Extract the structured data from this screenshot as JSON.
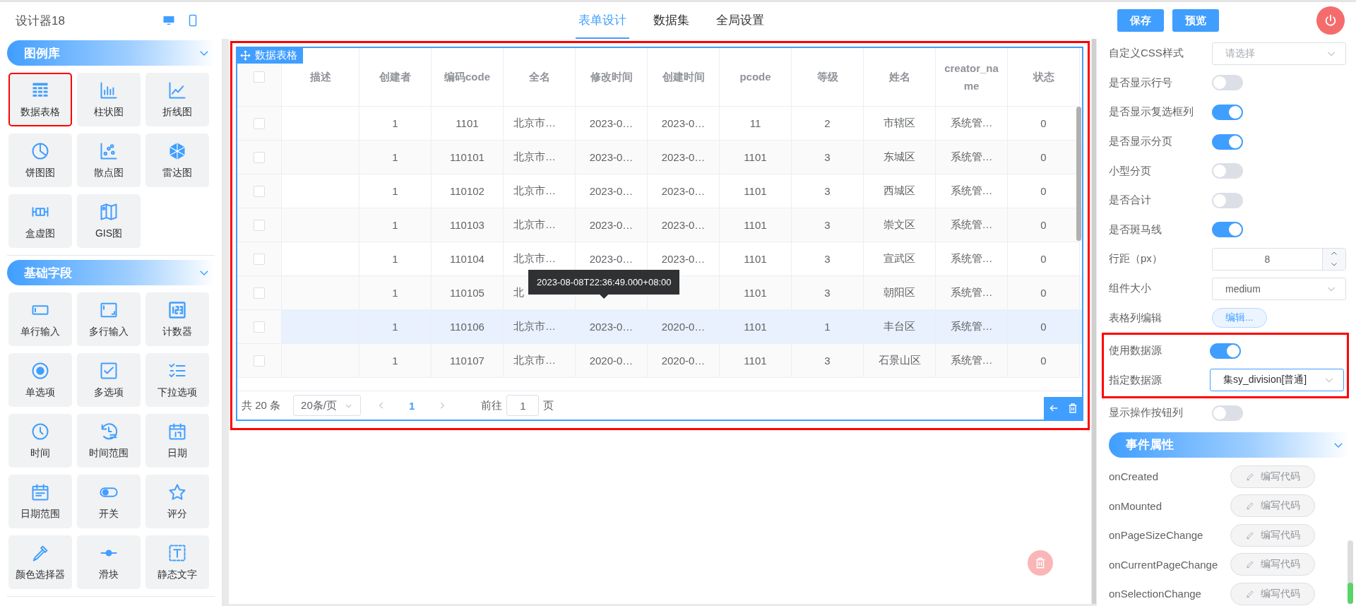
{
  "header": {
    "title": "设计器18",
    "tabs": [
      {
        "label": "表单设计",
        "selected": true
      },
      {
        "label": "数据集",
        "selected": false
      },
      {
        "label": "全局设置",
        "selected": false
      }
    ],
    "buttons": [
      "保存",
      "预览"
    ]
  },
  "palette": [
    {
      "title": "图例库",
      "expanded": true,
      "items": [
        {
          "label": "数据表格",
          "selected": true
        },
        {
          "label": "柱状图",
          "selected": false
        },
        {
          "label": "折线图",
          "selected": false
        },
        {
          "label": "饼图图",
          "selected": false
        },
        {
          "label": "散点图",
          "selected": false
        },
        {
          "label": "雷达图",
          "selected": false
        },
        {
          "label": "盒虚图",
          "selected": false
        },
        {
          "label": "GIS图",
          "selected": false
        }
      ]
    },
    {
      "title": "基础字段",
      "expanded": true,
      "items": [
        {
          "label": "单行输入",
          "selected": false
        },
        {
          "label": "多行输入",
          "selected": false
        },
        {
          "label": "计数器",
          "selected": false
        },
        {
          "label": "单选项",
          "selected": false
        },
        {
          "label": "多选项",
          "selected": false
        },
        {
          "label": "下拉选项",
          "selected": false
        },
        {
          "label": "时间",
          "selected": false
        },
        {
          "label": "时间范围",
          "selected": false
        },
        {
          "label": "日期",
          "selected": false
        },
        {
          "label": "日期范围",
          "selected": false
        },
        {
          "label": "开关",
          "selected": false
        },
        {
          "label": "评分",
          "selected": false
        },
        {
          "label": "颜色选择器",
          "selected": false
        },
        {
          "label": "滑块",
          "selected": false
        },
        {
          "label": "静态文字",
          "selected": false
        }
      ]
    }
  ],
  "table": {
    "tag": "数据表格",
    "columns": [
      "描述",
      "创建者",
      "编码code",
      "全名",
      "修改时间",
      "创建时间",
      "pcode",
      "等级",
      "姓名",
      "creator_name",
      "状态"
    ],
    "rows": [
      {
        "checked": false,
        "highlighted": false,
        "cells": [
          null,
          "1",
          "1101",
          "北京市…",
          "2023-0…",
          "2023-0…",
          "11",
          "2",
          "市辖区",
          "系统管…",
          "0"
        ]
      },
      {
        "checked": false,
        "highlighted": false,
        "cells": [
          null,
          "1",
          "110101",
          "北京市…",
          "2023-0…",
          "2023-0…",
          "1101",
          "3",
          "东城区",
          "系统管…",
          "0"
        ]
      },
      {
        "checked": false,
        "highlighted": false,
        "cells": [
          null,
          "1",
          "110102",
          "北京市…",
          "2023-0…",
          "2023-0…",
          "1101",
          "3",
          "西城区",
          "系统管…",
          "0"
        ]
      },
      {
        "checked": false,
        "highlighted": false,
        "cells": [
          null,
          "1",
          "110103",
          "北京市…",
          "2023-0…",
          "2023-0…",
          "1101",
          "3",
          "崇文区",
          "系统管…",
          "0"
        ]
      },
      {
        "checked": false,
        "highlighted": false,
        "cells": [
          null,
          "1",
          "110104",
          "北京市…",
          "2023-0…",
          "2023-0…",
          "1101",
          "3",
          "宣武区",
          "系统管…",
          "0"
        ]
      },
      {
        "checked": false,
        "highlighted": false,
        "cells": [
          null,
          "1",
          "110105",
          "北",
          null,
          null,
          "1101",
          "3",
          "朝阳区",
          "系统管…",
          "0"
        ]
      },
      {
        "checked": false,
        "highlighted": true,
        "cells": [
          null,
          "1",
          "110106",
          "北京市…",
          "2023-0…",
          "2020-0…",
          "1101",
          "1",
          "丰台区",
          "系统管…",
          "0"
        ]
      },
      {
        "checked": false,
        "highlighted": false,
        "cells": [
          null,
          "1",
          "110107",
          "北京市…",
          "2020-0…",
          "2020-0…",
          "1101",
          "3",
          "石景山区",
          "系统管…",
          "0"
        ]
      }
    ],
    "all_checked": false,
    "tooltip": "2023-08-08T22:36:49.000+08:00",
    "pagination": {
      "total": "共 20 条",
      "page_size": "20条/页",
      "pages": [
        {
          "label": "1",
          "selected": true
        }
      ],
      "goto_label": "前往",
      "goto_value": "1",
      "goto_suffix": "页"
    }
  },
  "properties": {
    "groups": [
      {
        "highlighted": false,
        "rows": [
          {
            "kind": "select",
            "label": "自定义CSS样式",
            "placeholder": "请选择"
          },
          {
            "kind": "switch",
            "label": "是否显示行号",
            "on": false
          },
          {
            "kind": "switch",
            "label": "是否显示复选框列",
            "on": true
          },
          {
            "kind": "switch",
            "label": "是否显示分页",
            "on": true
          },
          {
            "kind": "switch",
            "label": "小型分页",
            "on": false
          },
          {
            "kind": "switch",
            "label": "是否合计",
            "on": false
          },
          {
            "kind": "switch",
            "label": "是否斑马线",
            "on": true
          },
          {
            "kind": "number",
            "label": "行距（px）",
            "value": "8"
          },
          {
            "kind": "select",
            "label": "组件大小",
            "value": "medium"
          },
          {
            "kind": "button",
            "label": "表格列编辑",
            "button": "编辑..."
          }
        ]
      },
      {
        "highlighted": true,
        "rows": [
          {
            "kind": "switch",
            "label": "使用数据源",
            "on": true
          },
          {
            "kind": "select",
            "label": "指定数据源",
            "value": "集sy_division[普通]"
          }
        ]
      },
      {
        "highlighted": false,
        "rows": [
          {
            "kind": "switch",
            "label": "显示操作按钮列",
            "on": false
          }
        ]
      }
    ],
    "events_title": "事件属性",
    "events_expanded": true,
    "events": [
      {
        "name": "onCreated",
        "button": "编写代码"
      },
      {
        "name": "onMounted",
        "button": "编写代码"
      },
      {
        "name": "onPageSizeChange",
        "button": "编写代码"
      },
      {
        "name": "onCurrentPageChange",
        "button": "编写代码"
      },
      {
        "name": "onSelectionChange",
        "button": "编写代码"
      }
    ]
  }
}
